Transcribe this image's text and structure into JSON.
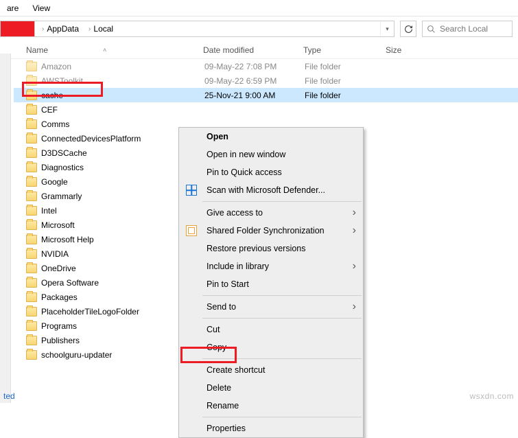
{
  "ribbon": {
    "share": "are",
    "view": "View"
  },
  "breadcrumb": {
    "appdata": "AppData",
    "local": "Local"
  },
  "search": {
    "placeholder": "Search Local"
  },
  "columns": {
    "name": "Name",
    "date": "Date modified",
    "type": "Type",
    "size": "Size"
  },
  "folders": [
    {
      "name": "Amazon",
      "date": "09-May-22 7:08 PM",
      "type": "File folder",
      "sel": false,
      "dis": true
    },
    {
      "name": "AWSToolkit",
      "date": "09-May-22 6:59 PM",
      "type": "File folder",
      "sel": false,
      "dis": true
    },
    {
      "name": "cache",
      "date": "25-Nov-21 9:00 AM",
      "type": "File folder",
      "sel": true,
      "dis": false
    },
    {
      "name": "CEF",
      "date": "",
      "type": "",
      "sel": false,
      "dis": false
    },
    {
      "name": "Comms",
      "date": "",
      "type": "",
      "sel": false,
      "dis": false
    },
    {
      "name": "ConnectedDevicesPlatform",
      "date": "",
      "type": "",
      "sel": false,
      "dis": false
    },
    {
      "name": "D3DSCache",
      "date": "",
      "type": "",
      "sel": false,
      "dis": false
    },
    {
      "name": "Diagnostics",
      "date": "",
      "type": "",
      "sel": false,
      "dis": false
    },
    {
      "name": "Google",
      "date": "",
      "type": "",
      "sel": false,
      "dis": false
    },
    {
      "name": "Grammarly",
      "date": "",
      "type": "",
      "sel": false,
      "dis": false
    },
    {
      "name": "Intel",
      "date": "",
      "type": "",
      "sel": false,
      "dis": false
    },
    {
      "name": "Microsoft",
      "date": "",
      "type": "",
      "sel": false,
      "dis": false
    },
    {
      "name": "Microsoft Help",
      "date": "",
      "type": "",
      "sel": false,
      "dis": false
    },
    {
      "name": "NVIDIA",
      "date": "",
      "type": "",
      "sel": false,
      "dis": false
    },
    {
      "name": "OneDrive",
      "date": "",
      "type": "",
      "sel": false,
      "dis": false
    },
    {
      "name": "Opera Software",
      "date": "",
      "type": "",
      "sel": false,
      "dis": false
    },
    {
      "name": "Packages",
      "date": "",
      "type": "",
      "sel": false,
      "dis": false
    },
    {
      "name": "PlaceholderTileLogoFolder",
      "date": "",
      "type": "",
      "sel": false,
      "dis": false
    },
    {
      "name": "Programs",
      "date": "",
      "type": "",
      "sel": false,
      "dis": false
    },
    {
      "name": "Publishers",
      "date": "",
      "type": "",
      "sel": false,
      "dis": false
    },
    {
      "name": "schoolguru-updater",
      "date": "",
      "type": "",
      "sel": false,
      "dis": false
    }
  ],
  "ctx": {
    "open": "Open",
    "open_new": "Open in new window",
    "pin_qa": "Pin to Quick access",
    "defender": "Scan with Microsoft Defender...",
    "give": "Give access to",
    "shared": "Shared Folder Synchronization",
    "restore": "Restore previous versions",
    "include": "Include in library",
    "pin_start": "Pin to Start",
    "send": "Send to",
    "cut": "Cut",
    "copy": "Copy",
    "shortcut": "Create shortcut",
    "delete": "Delete",
    "rename": "Rename",
    "props": "Properties"
  },
  "status": "ted",
  "watermark": "wsxdn.com"
}
